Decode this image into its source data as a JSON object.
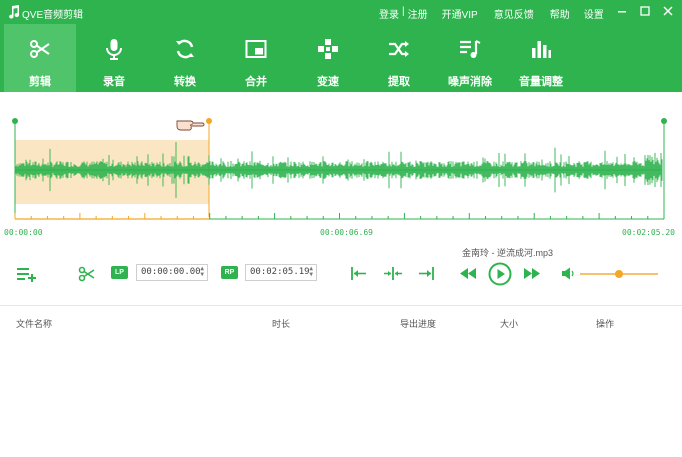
{
  "titlebar": {
    "app_title": "QVE音频剪辑",
    "login": "登录",
    "separator": "|",
    "register": "注册",
    "vip": "开通VIP",
    "feedback": "意见反馈",
    "help": "帮助",
    "settings": "设置"
  },
  "toolbar": {
    "tools": [
      {
        "label": "剪辑",
        "icon": "scissors-icon",
        "active": true
      },
      {
        "label": "录音",
        "icon": "microphone-icon",
        "active": false
      },
      {
        "label": "转换",
        "icon": "convert-icon",
        "active": false
      },
      {
        "label": "合并",
        "icon": "merge-icon",
        "active": false
      },
      {
        "label": "变速",
        "icon": "speed-icon",
        "active": false
      },
      {
        "label": "提取",
        "icon": "extract-icon",
        "active": false
      },
      {
        "label": "噪声消除",
        "icon": "noise-removal-icon",
        "active": false
      },
      {
        "label": "音量调整",
        "icon": "volume-adjust-icon",
        "active": false
      }
    ]
  },
  "waveform": {
    "time_start": "00:00:00",
    "time_mid": "00:00:06.69",
    "time_end": "00:02:05.20",
    "selection_color": "#fbe6c4",
    "wave_color": "#2fb34f",
    "marker_color": "#f5a623"
  },
  "controls": {
    "filename": "金南玲 - 逆流成河.mp3",
    "lp_tag": "LP",
    "rp_tag": "RP",
    "start_time": "00:00:00.00",
    "end_time": "00:02:05.19",
    "volume_level": 0.5
  },
  "table": {
    "columns": [
      "文件名称",
      "时长",
      "导出进度",
      "大小",
      "操作"
    ]
  },
  "colors": {
    "brand": "#2fb34f",
    "active_tab": "#4fc46b"
  }
}
